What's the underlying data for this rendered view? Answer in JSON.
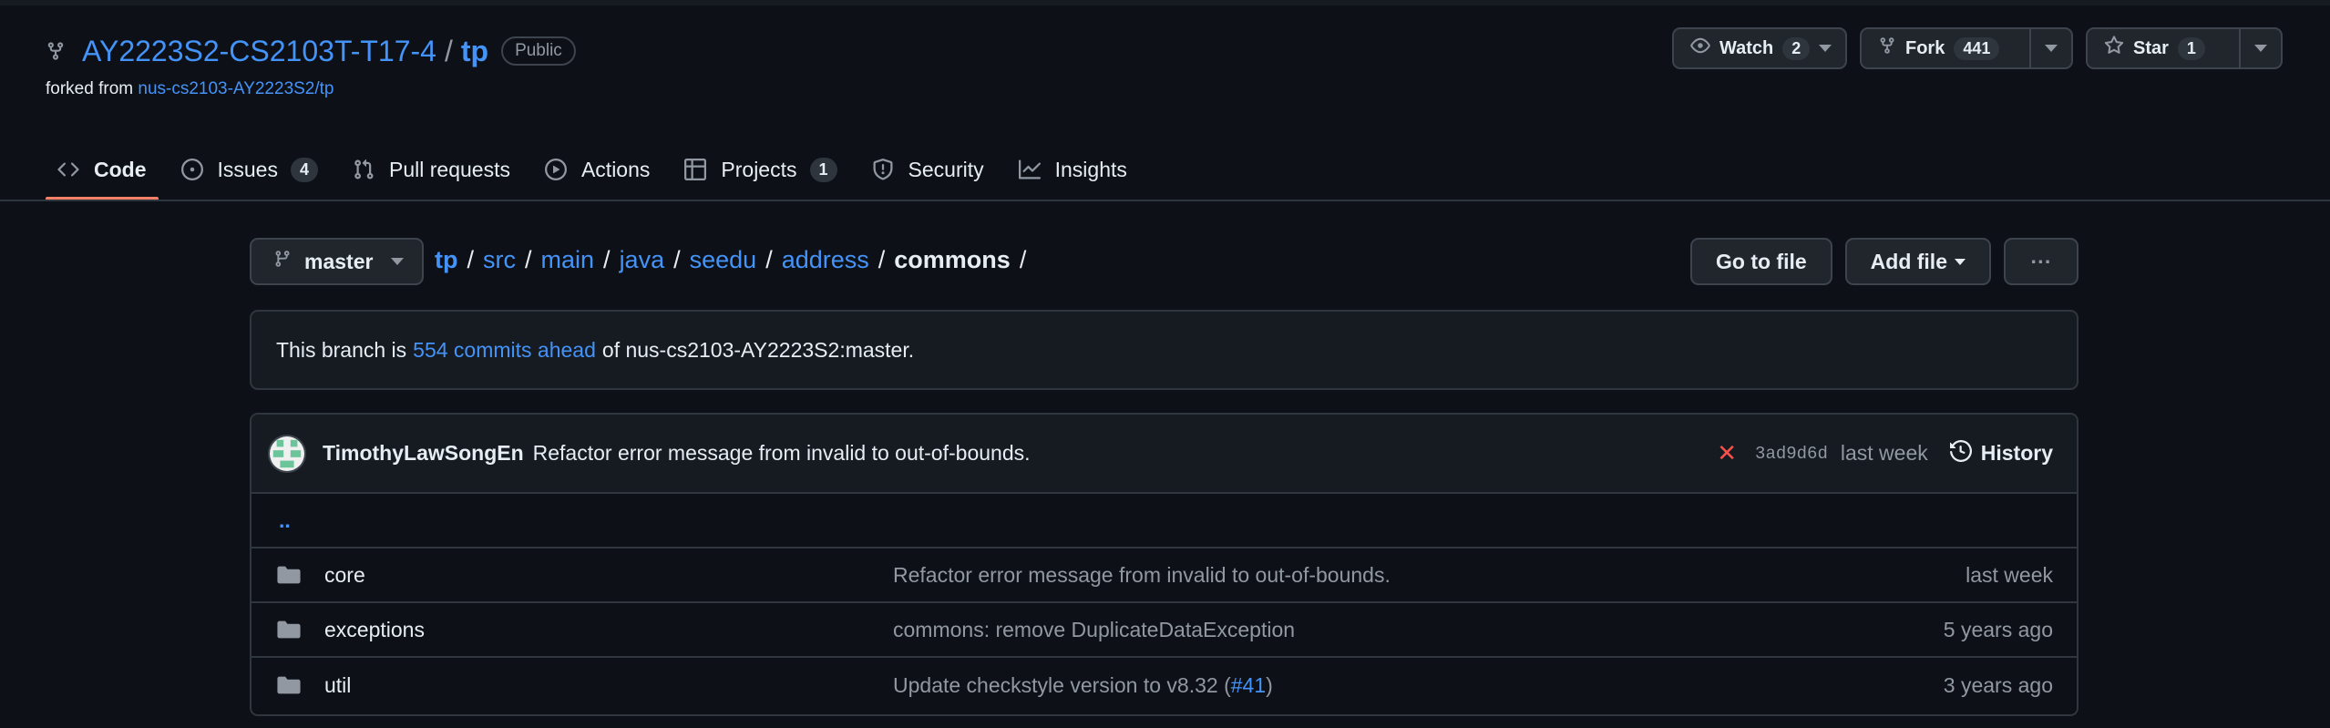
{
  "repo": {
    "owner": "AY2223S2-CS2103T-T17-4",
    "separator": "/",
    "name": "tp",
    "visibility": "Public",
    "forked_prefix": "forked from",
    "forked_from": "nus-cs2103-AY2223S2/tp"
  },
  "header_buttons": {
    "watch_label": "Watch",
    "watch_count": "2",
    "fork_label": "Fork",
    "fork_count": "441",
    "star_label": "Star",
    "star_count": "1"
  },
  "tabs": [
    {
      "label": "Code",
      "icon": "code-icon",
      "active": true
    },
    {
      "label": "Issues",
      "icon": "issue-opened-icon",
      "count": "4"
    },
    {
      "label": "Pull requests",
      "icon": "git-pull-request-icon"
    },
    {
      "label": "Actions",
      "icon": "play-icon"
    },
    {
      "label": "Projects",
      "icon": "table-icon",
      "count": "1"
    },
    {
      "label": "Security",
      "icon": "shield-icon"
    },
    {
      "label": "Insights",
      "icon": "graph-icon"
    }
  ],
  "branch": {
    "name": "master"
  },
  "breadcrumb": {
    "segments": [
      "tp",
      "src",
      "main",
      "java",
      "seedu",
      "address"
    ],
    "current": "commons",
    "separator": "/"
  },
  "toolbar": {
    "goto_file": "Go to file",
    "add_file": "Add file",
    "more": "···"
  },
  "ahead": {
    "prefix": "This branch is",
    "link": "554 commits ahead",
    "suffix": "of nus-cs2103-AY2223S2:master."
  },
  "latest_commit": {
    "author": "TimothyLawSongEn",
    "message": "Refactor error message from invalid to out-of-bounds.",
    "status": "✕",
    "sha": "3ad9d6d",
    "when": "last week",
    "history_label": "History"
  },
  "parent_dir": "..",
  "files": [
    {
      "name": "core",
      "message": "Refactor error message from invalid to out-of-bounds.",
      "when": "last week"
    },
    {
      "name": "exceptions",
      "message": "commons: remove DuplicateDataException",
      "when": "5 years ago"
    },
    {
      "name": "util",
      "message_prefix": "Update checkstyle version to v8.32 (",
      "message_link": "#41",
      "message_suffix": ")",
      "when": "3 years ago"
    }
  ],
  "colors": {
    "background": "#0d1117",
    "link": "#4493f8",
    "active_tab_underline": "#f78166",
    "fail": "#f85149"
  }
}
